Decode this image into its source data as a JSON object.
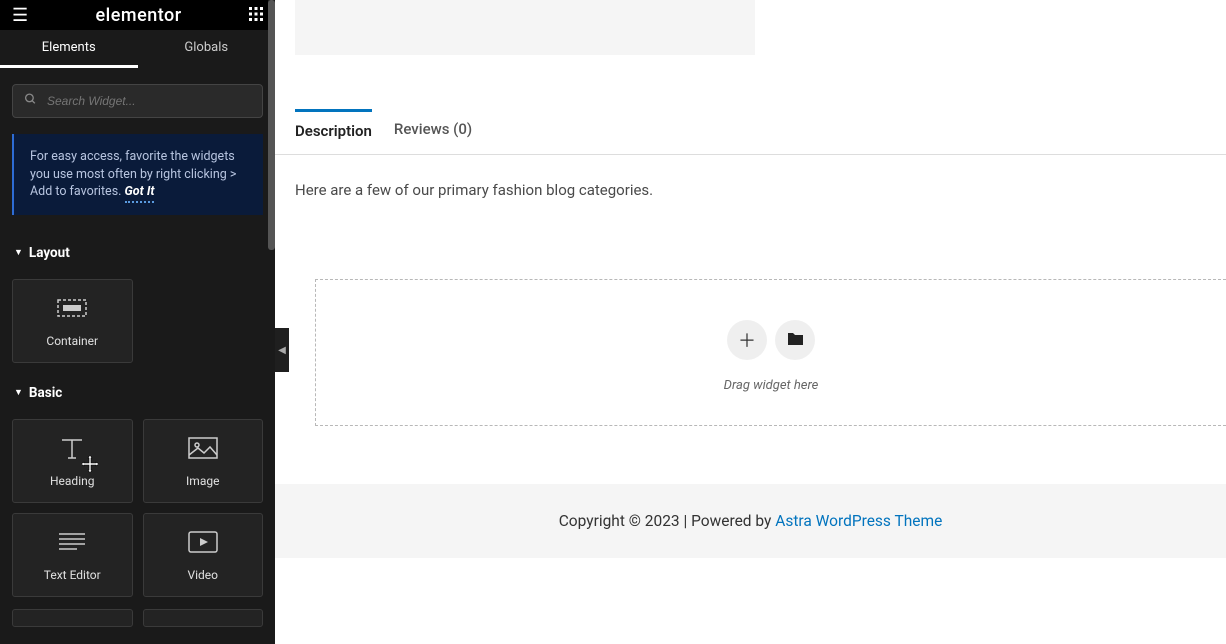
{
  "sidebar": {
    "logo": "elementor",
    "tabs": {
      "elements": "Elements",
      "globals": "Globals"
    },
    "search_placeholder": "Search Widget...",
    "tip": {
      "text": "For easy access, favorite the widgets you use most often by right clicking > Add to favorites.",
      "got_it": "Got It"
    },
    "sections": {
      "layout": "Layout",
      "basic": "Basic"
    },
    "widgets": {
      "container": "Container",
      "heading": "Heading",
      "image": "Image",
      "text_editor": "Text Editor",
      "video": "Video"
    }
  },
  "main": {
    "tabs": {
      "description": "Description",
      "reviews": "Reviews (0)"
    },
    "description_text": "Here are a few of our primary fashion blog categories.",
    "dropzone_text": "Drag widget here"
  },
  "footer": {
    "copyright": "Copyright © 2023 | Powered by ",
    "link_text": "Astra WordPress Theme"
  }
}
